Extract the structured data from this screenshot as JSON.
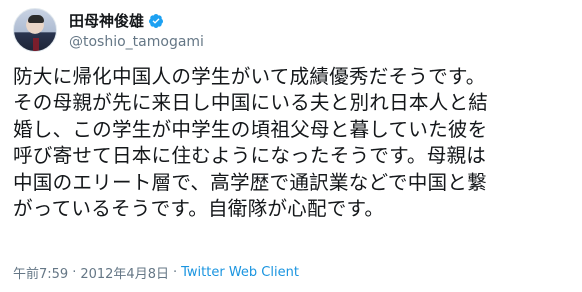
{
  "user": {
    "display_name": "田母神俊雄",
    "handle": "@toshio_tamogami",
    "verified": true
  },
  "tweet": {
    "lines": [
      "防大に帰化中国人の学生がいて成績優秀だそうです。",
      "その母親が先に来日し中国にいる夫と別れ日本人と結",
      "婚し、この学生が中学生の頃祖父母と暮していた彼を",
      "呼び寄せて日本に住むようになったそうです。母親は",
      "中国のエリート層で、高学歴で通訳業などで中国と繋",
      "がっているそうです。自衛隊が心配です。"
    ]
  },
  "footer": {
    "time": "午前7:59",
    "separator": "·",
    "date": "2012年4月8日",
    "client": "Twitter Web Client"
  },
  "colors": {
    "verified_badge": "#1da1f2",
    "link": "#1b95e0",
    "secondary_text": "#657786"
  }
}
